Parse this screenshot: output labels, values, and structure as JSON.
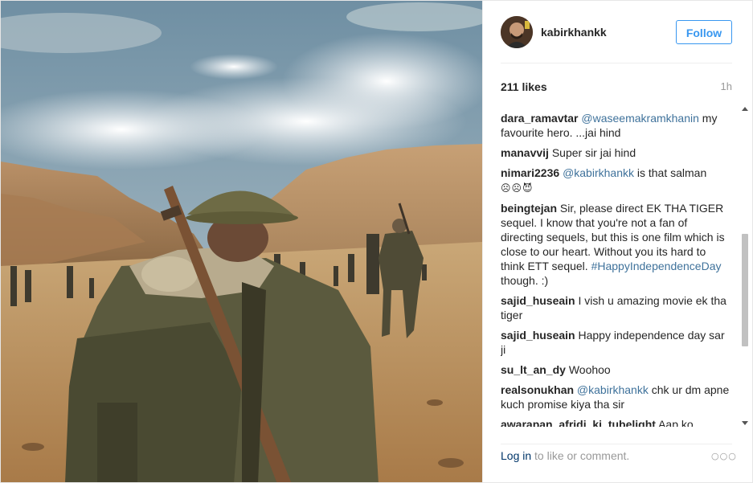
{
  "post": {
    "username": "kabirkhankk",
    "follow_label": "Follow",
    "likes": "211 likes",
    "time": "1h"
  },
  "comments": [
    {
      "user": "dara_ramavtar",
      "mention": "@waseemakramkhanin",
      "text": "my favourite hero. ...jai hind"
    },
    {
      "user": "manavvij",
      "mention": "",
      "text": "Super sir jai hind"
    },
    {
      "user": "nimari2236",
      "mention": "@kabirkhankk",
      "text": "is that salman",
      "emoji": "☹☹😈"
    },
    {
      "user": "beingtejan",
      "mention": "",
      "text": "Sir, please direct EK THA TIGER sequel. I know that you're not a fan of directing sequels, but this is one film which is close to our heart. Without you its hard to think ETT sequel.",
      "hashtag": "#HappyIndependenceDay",
      "tail": "though. :)"
    },
    {
      "user": "sajid_huseain",
      "mention": "",
      "text": "I vish u amazing movie ek tha tiger"
    },
    {
      "user": "sajid_huseain",
      "mention": "",
      "text": "Happy independence day sar ji"
    },
    {
      "user": "su_lt_an_dy",
      "mention": "",
      "text": "Woohoo"
    },
    {
      "user": "realsonukhan",
      "mention": "@kabirkhankk",
      "text": "chk ur dm apne kuch promise kiya tha sir"
    },
    {
      "user": "awarapan_afridi_ki_tubelight",
      "mention": "",
      "text": "Aap ko"
    }
  ],
  "footer": {
    "login_link": "Log in",
    "login_rest": " to like or comment.",
    "more_icon": "ellipsis-icon"
  },
  "colors": {
    "accent": "#3897f0",
    "mention": "#3f729b",
    "muted": "#999999"
  }
}
